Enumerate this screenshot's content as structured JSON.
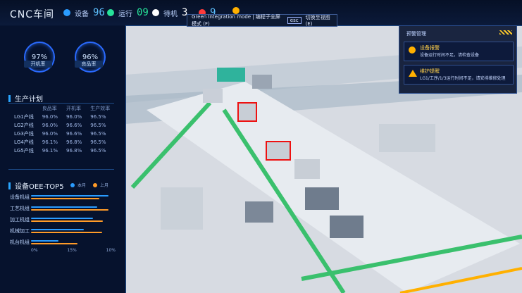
{
  "header": {
    "title": "CNC车间",
    "kpis": [
      {
        "label": "设备",
        "value": "96",
        "color": "#5ec1ff"
      },
      {
        "label": "运行",
        "value": "09",
        "color": "#27e39a"
      },
      {
        "label": "待机",
        "value": "3",
        "color": "#ffffff"
      },
      {
        "label": "",
        "value": "9",
        "color": "#ffffff"
      },
      {
        "label": "",
        "value": "",
        "color": "#ffffff"
      }
    ],
    "status_chip": {
      "text": "Green Integration mode | 编程子全屏模式 (F)",
      "mode": "esc",
      "after": "切换至视图(E)"
    }
  },
  "left": {
    "gauges": [
      {
        "value": "97%",
        "label": "开机率"
      },
      {
        "value": "96%",
        "label": "良品率"
      }
    ],
    "production": {
      "title": "生产计划",
      "columns": [
        "",
        "良品率",
        "开机率",
        "生产效率"
      ],
      "rows": [
        {
          "name": "LG1产线",
          "cols": [
            "96.0%",
            "96.0%",
            "96.5%"
          ]
        },
        {
          "name": "LG2产线",
          "cols": [
            "96.0%",
            "96.6%",
            "96.5%"
          ]
        },
        {
          "name": "LG3产线",
          "cols": [
            "96.0%",
            "96.6%",
            "96.5%"
          ]
        },
        {
          "name": "LG4产线",
          "cols": [
            "96.1%",
            "96.8%",
            "96.5%"
          ]
        },
        {
          "name": "LG5产线",
          "cols": [
            "96.1%",
            "96.8%",
            "96.5%"
          ]
        }
      ]
    },
    "oee": {
      "title": "设备OEE-TOP5",
      "legend": [
        {
          "name": "本月",
          "color": "#2a9cff"
        },
        {
          "name": "上月",
          "color": "#ff9b28"
        }
      ],
      "items": [
        {
          "label": "设备机组",
          "blue": 1.0,
          "orange": 0.88
        },
        {
          "label": "工艺机组",
          "blue": 0.85,
          "orange": 1.0
        },
        {
          "label": "加工机组",
          "blue": 0.8,
          "orange": 0.93
        },
        {
          "label": "机械加工",
          "blue": 0.68,
          "orange": 0.92
        },
        {
          "label": "机台机组",
          "blue": 0.35,
          "orange": 0.6
        }
      ],
      "axis": [
        "0%",
        "15%",
        "10%"
      ]
    }
  },
  "right": {
    "title": "预警管理",
    "alerts": [
      {
        "title": "设备报警",
        "body": "设备运行时间不足，请检查设备"
      },
      {
        "title": "维护提醒",
        "body": "LG1/工序/1/3运行时间不足，请安排维修处理"
      }
    ]
  }
}
